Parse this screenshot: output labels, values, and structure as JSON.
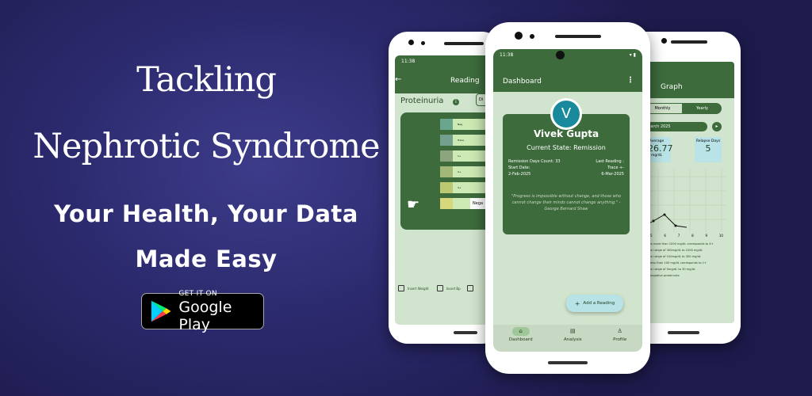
{
  "promo": {
    "headline_1": "Tackling",
    "headline_2": "Nephrotic Syndrome",
    "tagline_1": "Your Health, Your Data",
    "tagline_2": "Made Easy",
    "store_small": "GET IT ON",
    "store_big": "Google Play"
  },
  "colors": {
    "background": "#2c2a6e",
    "app_green": "#3d6b3c",
    "app_light": "#d1e4cd",
    "accent": "#188a9c"
  },
  "left_phone": {
    "status_time": "11:38",
    "title": "Reading",
    "section": "Proteinuria",
    "dropdown": "Di",
    "strips": [
      "Neg",
      "Trace",
      "1+",
      "2+",
      "3+",
      "4+"
    ],
    "selected_label": "Nega",
    "checkboxes": [
      "Insert Weight",
      "Insert Bp",
      ""
    ]
  },
  "center_phone": {
    "status_time": "11:38",
    "title": "Dashboard",
    "avatar_letter": "V",
    "user_name": "Vivek Gupta",
    "current_state": "Current State: Remission",
    "remission_label": "Remission Days Count: 33",
    "start_label": "Start Date:",
    "start_value": "2-Feb-2025",
    "last_label": "Last Reading :",
    "last_result": "Trace +-",
    "last_value": "6-Mar-2025",
    "quote": "\"Progress is impossible without change, and those who cannot change their minds cannot change anything.\" - George Bernard Shaw",
    "fab_label": "Add a Reading",
    "nav": [
      "Dashboard",
      "Analysis",
      "Profile"
    ]
  },
  "right_phone": {
    "title": "Graph",
    "tabs": [
      "Monthly",
      "Yearly"
    ],
    "month": "March 2025",
    "average_label": "Average",
    "average_value": "126.77",
    "average_unit": "mg/dL",
    "relapse_label": "Relapse Days",
    "relapse_value": "5",
    "x_ticks": [
      "5",
      "6",
      "7",
      "8",
      "9",
      "10"
    ],
    "legend": [
      "is more than 1000 mg/dL corresponds to 4+",
      "in range of 300mg/dL to 1000 mg/dL",
      "in range of 100mg/dL to 300 mg/dL",
      "less than 100 mg/dL corresponds to 1+",
      "in range of 0mg/dL to 30 mg/dL",
      "negative proteinuria"
    ]
  }
}
